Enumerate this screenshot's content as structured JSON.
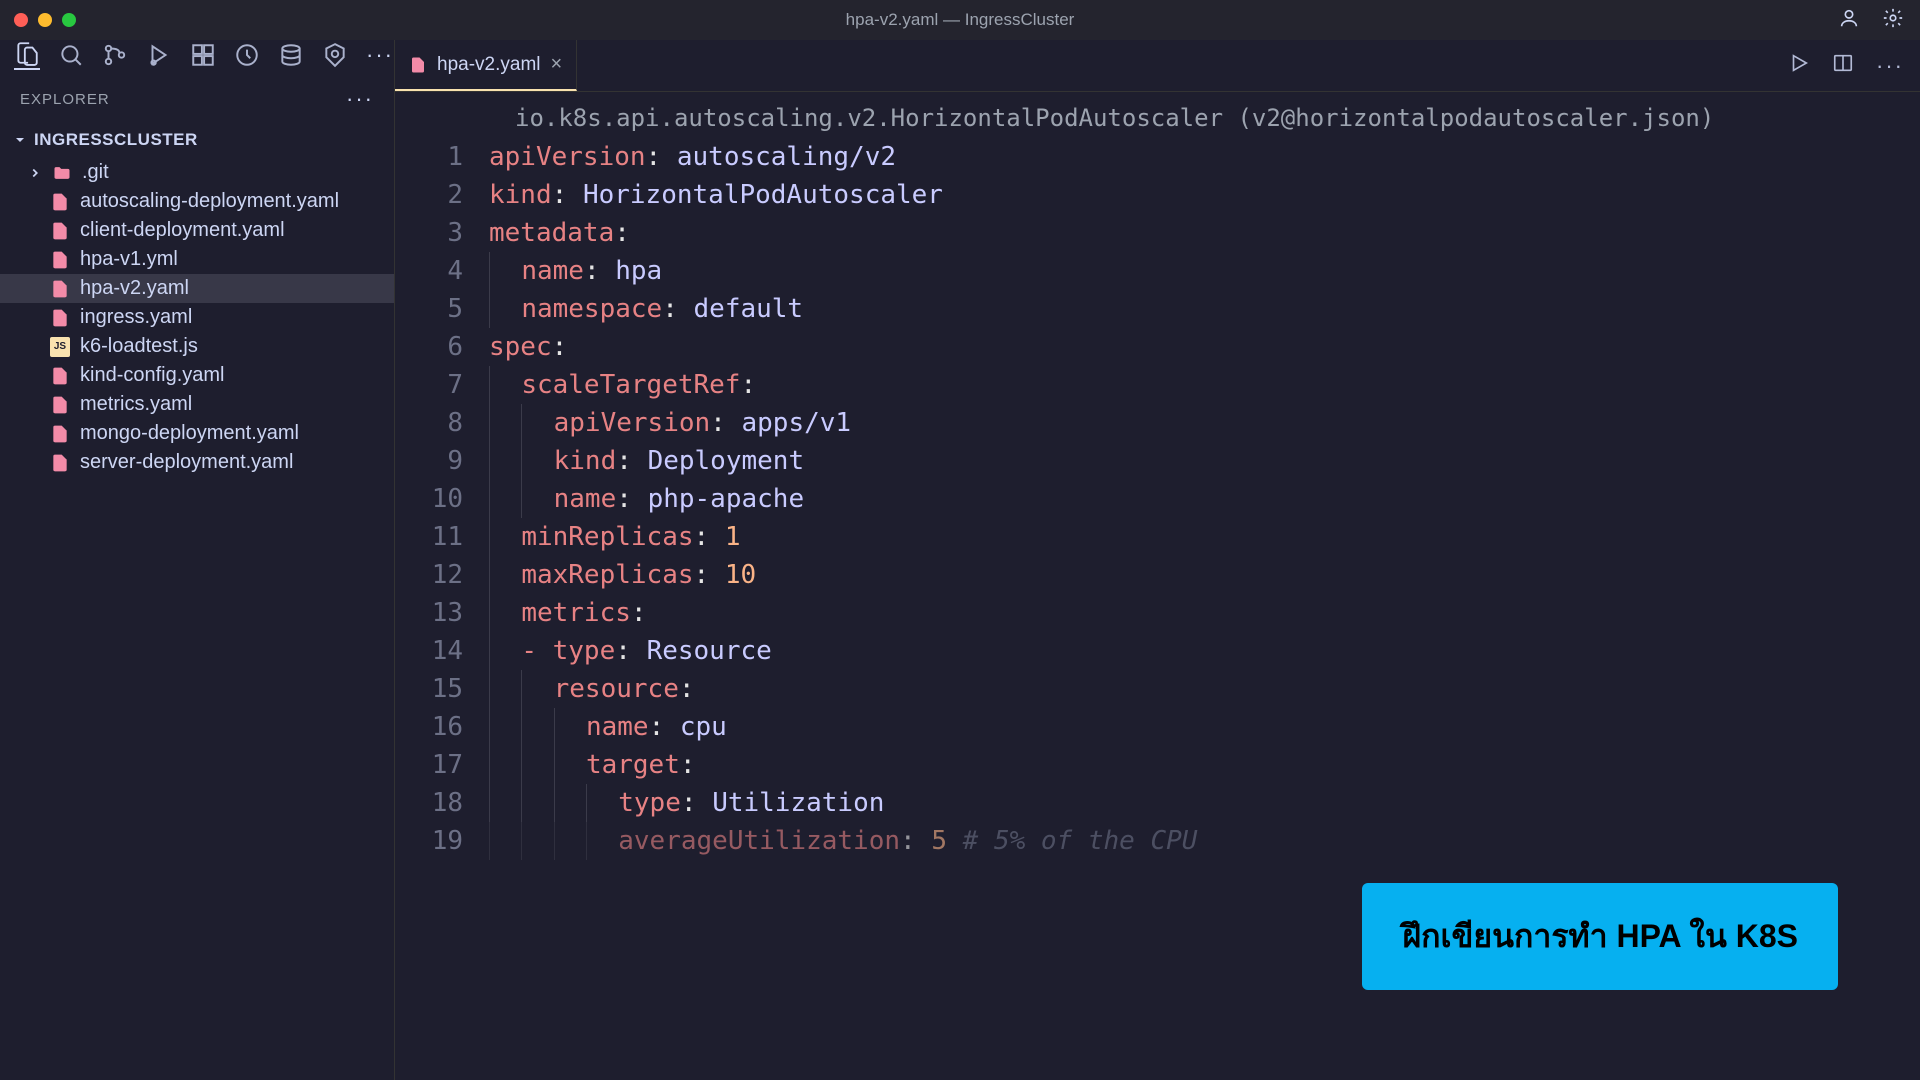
{
  "window": {
    "title": "hpa-v2.yaml — IngressCluster"
  },
  "sidebar": {
    "title": "EXPLORER",
    "project": "INGRESSCLUSTER",
    "items": [
      {
        "type": "folder",
        "label": ".git",
        "iconType": "git-folder"
      },
      {
        "type": "file",
        "label": "autoscaling-deployment.yaml",
        "iconType": "yaml"
      },
      {
        "type": "file",
        "label": "client-deployment.yaml",
        "iconType": "yaml"
      },
      {
        "type": "file",
        "label": "hpa-v1.yml",
        "iconType": "yaml"
      },
      {
        "type": "file",
        "label": "hpa-v2.yaml",
        "iconType": "yaml",
        "selected": true
      },
      {
        "type": "file",
        "label": "ingress.yaml",
        "iconType": "yaml"
      },
      {
        "type": "file",
        "label": "k6-loadtest.js",
        "iconType": "js"
      },
      {
        "type": "file",
        "label": "kind-config.yaml",
        "iconType": "yaml"
      },
      {
        "type": "file",
        "label": "metrics.yaml",
        "iconType": "yaml"
      },
      {
        "type": "file",
        "label": "mongo-deployment.yaml",
        "iconType": "yaml"
      },
      {
        "type": "file",
        "label": "server-deployment.yaml",
        "iconType": "yaml"
      }
    ]
  },
  "tab": {
    "label": "hpa-v2.yaml"
  },
  "breadcrumb": "io.k8s.api.autoscaling.v2.HorizontalPodAutoscaler (v2@horizontalpodautoscaler.json)",
  "code": {
    "lines": [
      {
        "n": 1,
        "ind": 0,
        "tokens": [
          [
            "k",
            "apiVersion"
          ],
          [
            "c",
            ": "
          ],
          [
            "v",
            "autoscaling/v2"
          ]
        ]
      },
      {
        "n": 2,
        "ind": 0,
        "tokens": [
          [
            "k",
            "kind"
          ],
          [
            "c",
            ": "
          ],
          [
            "v",
            "HorizontalPodAutoscaler"
          ]
        ]
      },
      {
        "n": 3,
        "ind": 0,
        "tokens": [
          [
            "k",
            "metadata"
          ],
          [
            "c",
            ":"
          ]
        ]
      },
      {
        "n": 4,
        "ind": 1,
        "tokens": [
          [
            "k",
            "name"
          ],
          [
            "c",
            ": "
          ],
          [
            "v",
            "hpa"
          ]
        ]
      },
      {
        "n": 5,
        "ind": 1,
        "tokens": [
          [
            "k",
            "namespace"
          ],
          [
            "c",
            ": "
          ],
          [
            "v",
            "default"
          ]
        ]
      },
      {
        "n": 6,
        "ind": 0,
        "tokens": [
          [
            "k",
            "spec"
          ],
          [
            "c",
            ":"
          ]
        ]
      },
      {
        "n": 7,
        "ind": 1,
        "tokens": [
          [
            "k",
            "scaleTargetRef"
          ],
          [
            "c",
            ":"
          ]
        ]
      },
      {
        "n": 8,
        "ind": 2,
        "tokens": [
          [
            "k",
            "apiVersion"
          ],
          [
            "c",
            ": "
          ],
          [
            "v",
            "apps/v1"
          ]
        ]
      },
      {
        "n": 9,
        "ind": 2,
        "tokens": [
          [
            "k",
            "kind"
          ],
          [
            "c",
            ": "
          ],
          [
            "v",
            "Deployment"
          ]
        ]
      },
      {
        "n": 10,
        "ind": 2,
        "tokens": [
          [
            "k",
            "name"
          ],
          [
            "c",
            ": "
          ],
          [
            "v",
            "php-apache"
          ]
        ]
      },
      {
        "n": 11,
        "ind": 1,
        "tokens": [
          [
            "k",
            "minReplicas"
          ],
          [
            "c",
            ": "
          ],
          [
            "n",
            "1"
          ]
        ]
      },
      {
        "n": 12,
        "ind": 1,
        "tokens": [
          [
            "k",
            "maxReplicas"
          ],
          [
            "c",
            ": "
          ],
          [
            "n",
            "10"
          ]
        ]
      },
      {
        "n": 13,
        "ind": 1,
        "tokens": [
          [
            "k",
            "metrics"
          ],
          [
            "c",
            ":"
          ]
        ]
      },
      {
        "n": 14,
        "ind": 1,
        "tokens": [
          [
            "d",
            "- "
          ],
          [
            "k",
            "type"
          ],
          [
            "c",
            ": "
          ],
          [
            "v",
            "Resource"
          ]
        ]
      },
      {
        "n": 15,
        "ind": 2,
        "tokens": [
          [
            "k",
            "resource"
          ],
          [
            "c",
            ":"
          ]
        ]
      },
      {
        "n": 16,
        "ind": 3,
        "tokens": [
          [
            "k",
            "name"
          ],
          [
            "c",
            ": "
          ],
          [
            "v",
            "cpu"
          ]
        ]
      },
      {
        "n": 17,
        "ind": 3,
        "tokens": [
          [
            "k",
            "target"
          ],
          [
            "c",
            ":"
          ]
        ]
      },
      {
        "n": 18,
        "ind": 4,
        "tokens": [
          [
            "k",
            "type"
          ],
          [
            "c",
            ": "
          ],
          [
            "v",
            "Utilization"
          ]
        ]
      },
      {
        "n": 19,
        "ind": 4,
        "cut": true,
        "tokens": [
          [
            "k",
            "averageUtilization"
          ],
          [
            "c",
            ": "
          ],
          [
            "n",
            "5"
          ],
          [
            "c",
            " "
          ],
          [
            "cmt",
            "# 5% of the CPU"
          ]
        ]
      }
    ]
  },
  "callout": {
    "text": "ฝึกเขียนการทำ HPA ใน K8S"
  }
}
